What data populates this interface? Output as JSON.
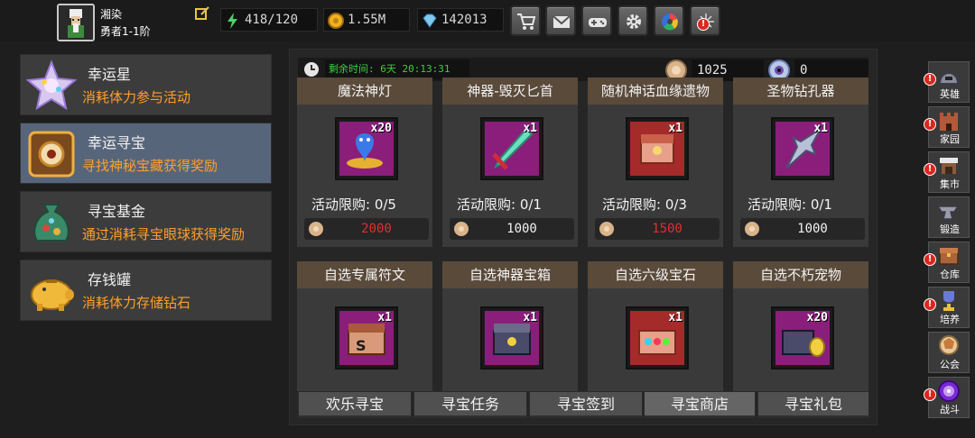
{
  "player": {
    "name": "湘染",
    "level": "勇者1-1阶"
  },
  "resources": {
    "stamina": "418/120",
    "gold": "1.55M",
    "diamonds": "142013"
  },
  "toolbar": {
    "icons": [
      "cart-icon",
      "mail-icon",
      "gamepad-icon",
      "gear-icon",
      "color-wheel-icon",
      "sparkle-icon"
    ]
  },
  "left_menu": [
    {
      "title": "幸运星",
      "desc": "消耗体力参与活动"
    },
    {
      "title": "幸运寻宝",
      "desc": "寻找神秘宝藏获得奖励"
    },
    {
      "title": "寻宝基金",
      "desc": "通过消耗寻宝眼球获得奖励"
    },
    {
      "title": "存钱罐",
      "desc": "消耗体力存储钻石"
    }
  ],
  "shop": {
    "timer": "剩余时间: 6天 20:13:31",
    "currency1": "1025",
    "currency2": "0",
    "row1": [
      {
        "title": "魔法神灯",
        "qty": "x20",
        "limit": "活动限购: 0/5",
        "price": "2000",
        "price_color": "#e03030"
      },
      {
        "title": "神器-毁灭匕首",
        "qty": "x1",
        "limit": "活动限购: 0/1",
        "price": "1000",
        "price_color": "#f3f3f3"
      },
      {
        "title": "随机神话血缘遗物",
        "qty": "x1",
        "limit": "活动限购: 0/3",
        "price": "1500",
        "price_color": "#e03030"
      },
      {
        "title": "圣物钻孔器",
        "qty": "x1",
        "limit": "活动限购: 0/1",
        "price": "1000",
        "price_color": "#f3f3f3"
      }
    ],
    "row2": [
      {
        "title": "自选专属符文",
        "qty": "x1"
      },
      {
        "title": "自选神器宝箱",
        "qty": "x1"
      },
      {
        "title": "自选六级宝石",
        "qty": "x1"
      },
      {
        "title": "自选不朽宠物",
        "qty": "x20"
      }
    ]
  },
  "tabs": [
    "欢乐寻宝",
    "寻宝任务",
    "寻宝签到",
    "寻宝商店",
    "寻宝礼包"
  ],
  "side_nav": [
    "英雄",
    "家园",
    "集市",
    "锻造",
    "仓库",
    "培养",
    "公会",
    "战斗"
  ],
  "colors": {
    "accent_orange": "#ff9f2a",
    "timer_green": "#3ecf3e",
    "alert_red": "#d8281f"
  }
}
